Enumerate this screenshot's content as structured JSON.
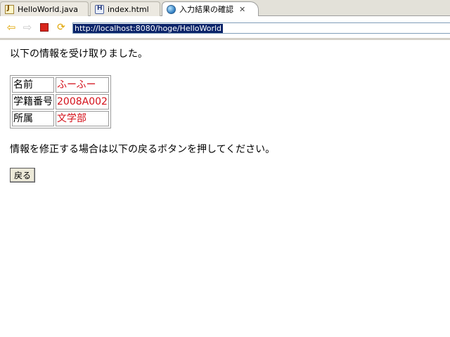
{
  "tabs": [
    {
      "label": "HelloWorld.java",
      "icon": "java-file-icon"
    },
    {
      "label": "index.html",
      "icon": "html-file-icon"
    },
    {
      "label": "入力結果の確認",
      "icon": "globe-icon",
      "close": "✕"
    }
  ],
  "toolbar": {
    "url": "http://localhost:8080/hoge/HelloWorld"
  },
  "page": {
    "intro": "以下の情報を受け取りました。",
    "table": {
      "rows": [
        {
          "label": "名前",
          "value": "ふーふー"
        },
        {
          "label": "学籍番号",
          "value": "2008A002"
        },
        {
          "label": "所属",
          "value": "文学部"
        }
      ]
    },
    "note": "情報を修正する場合は以下の戻るボタンを押してください。",
    "back_button": "戻る"
  },
  "colors": {
    "value_text": "#d4101a",
    "url_highlight": "#0a246a"
  }
}
